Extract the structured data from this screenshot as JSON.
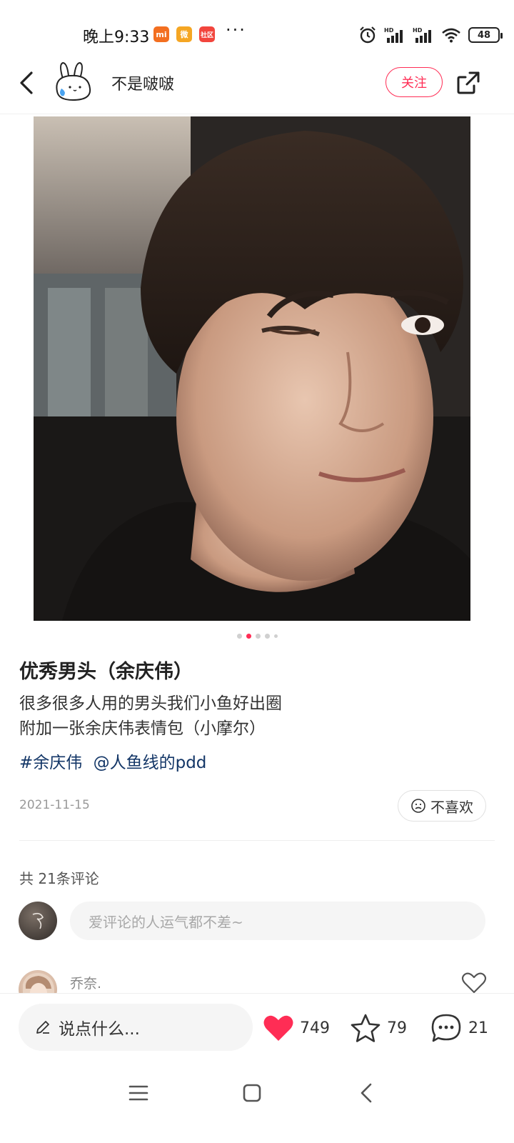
{
  "status_bar": {
    "time": "晚上9:33",
    "badges": [
      "mi",
      "微",
      "社区"
    ],
    "more": "···",
    "battery": "48"
  },
  "header": {
    "author_name": "不是啵啵",
    "follow_label": "关注"
  },
  "photo": {
    "page_count": 5,
    "active_index": 1
  },
  "note": {
    "title": "优秀男头（余庆伟）",
    "body_line1": "很多很多人用的男头我们小鱼好出圈",
    "body_line2": "附加一张余庆伟表情包（小摩尔）",
    "tags": [
      "#余庆伟",
      "@人鱼线的pdd"
    ],
    "date": "2021-11-15",
    "dislike_label": "不喜欢"
  },
  "comments": {
    "count_label": "共 21条评论",
    "input_placeholder": "爱评论的人运气都不差~",
    "first_commenter": "乔奈."
  },
  "bottom_bar": {
    "say_placeholder": "说点什么...",
    "likes": "749",
    "stars": "79",
    "comments": "21"
  },
  "colors": {
    "accent": "#ff2d55",
    "tag": "#133667"
  }
}
